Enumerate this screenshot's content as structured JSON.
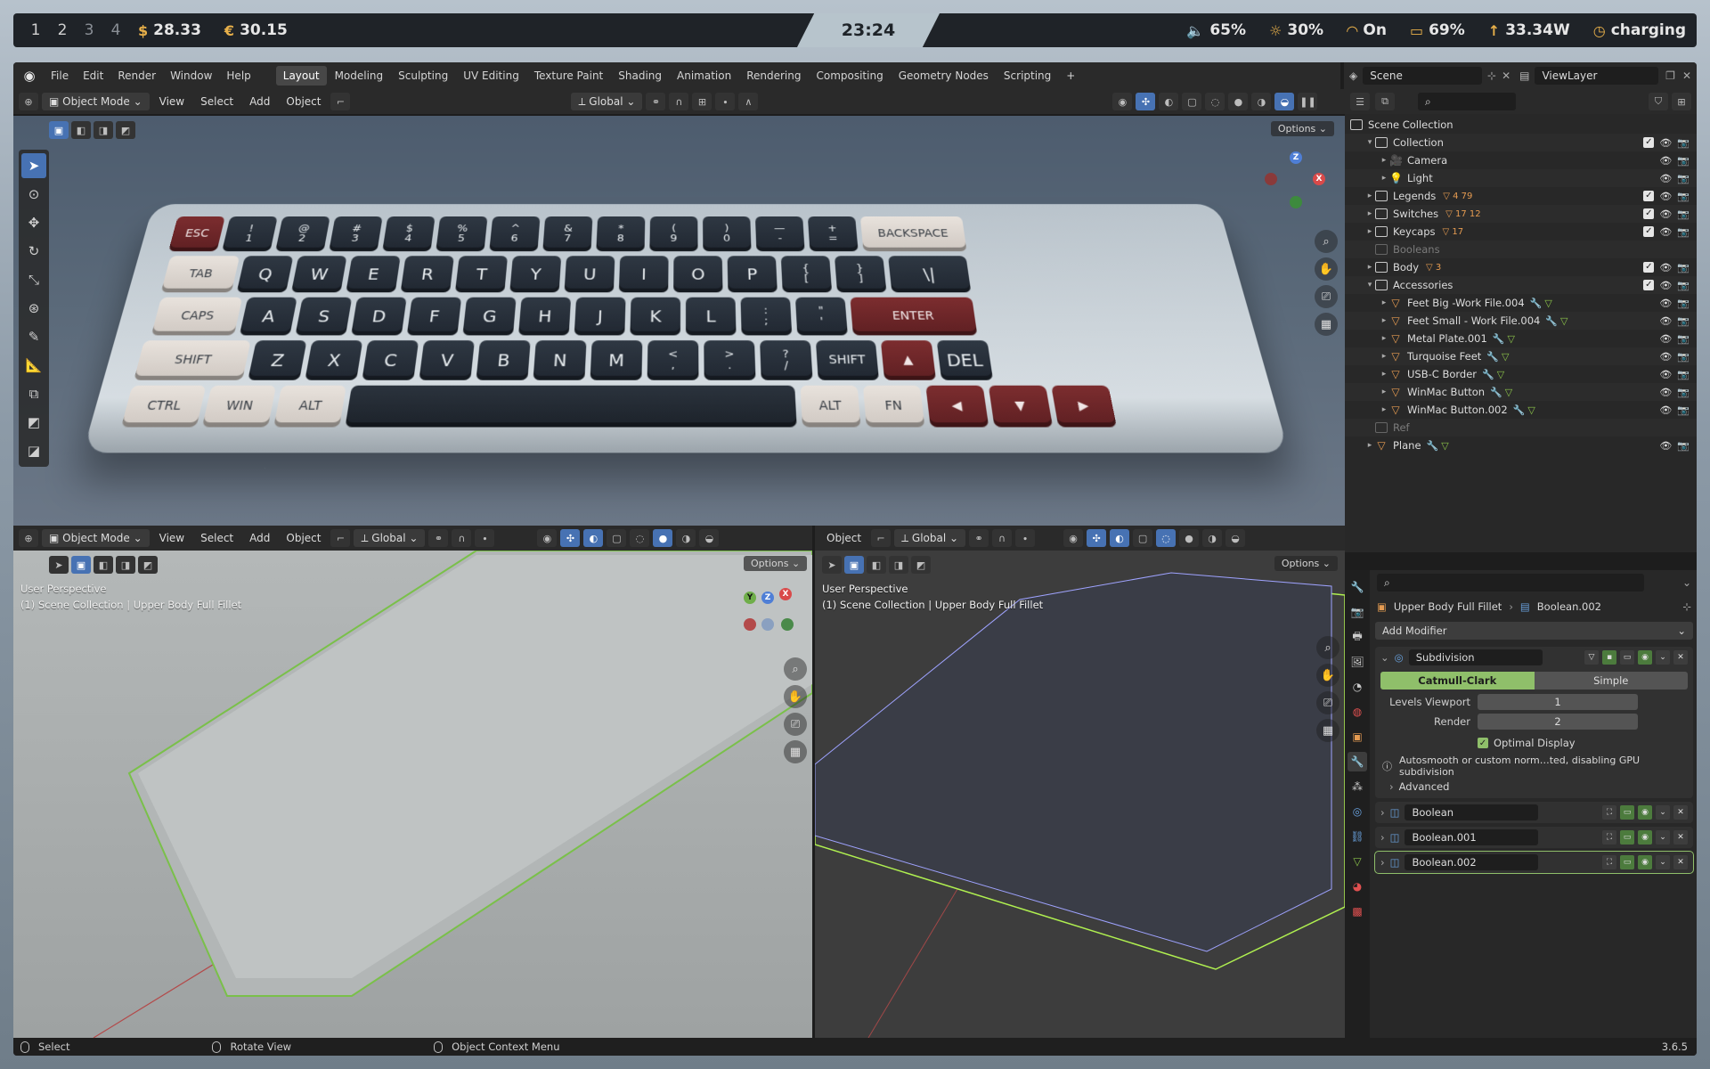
{
  "sysbar": {
    "workspaces": [
      "1",
      "2",
      "3",
      "4"
    ],
    "usd": "28.33",
    "eur": "30.15",
    "usd_icon": "$",
    "eur_icon": "€",
    "clock": "23:24",
    "volume": "65%",
    "brightness": "30%",
    "wifi": "On",
    "battery": "69%",
    "power": "33.34W",
    "charge_state": "charging"
  },
  "blender": {
    "menus": [
      "File",
      "Edit",
      "Render",
      "Window",
      "Help"
    ],
    "workspace_tabs": [
      "Layout",
      "Modeling",
      "Sculpting",
      "UV Editing",
      "Texture Paint",
      "Shading",
      "Animation",
      "Rendering",
      "Compositing",
      "Geometry Nodes",
      "Scripting"
    ],
    "active_tab": "Layout",
    "add_tab": "+",
    "scene_name": "Scene",
    "view_layer": "ViewLayer"
  },
  "viewport_header": {
    "mode": "Object Mode",
    "view": "View",
    "select": "Select",
    "add": "Add",
    "object": "Object",
    "orientation": "Global"
  },
  "viewport_main": {
    "options": "Options",
    "keyboard_rows": [
      [
        "ESC",
        "!\n1",
        "@\n2",
        "#\n3",
        "$\n4",
        "%\n5",
        "^\n6",
        "&\n7",
        "*\n8",
        "(\n9",
        ")\n0",
        "—\n-",
        "+\n=",
        "BACKSPACE"
      ],
      [
        "TAB",
        "Q",
        "W",
        "E",
        "R",
        "T",
        "Y",
        "U",
        "I",
        "O",
        "P",
        "{\n[",
        "}\n]",
        "\\|"
      ],
      [
        "CAPS",
        "A",
        "S",
        "D",
        "F",
        "G",
        "H",
        "J",
        "K",
        "L",
        ":\n;",
        "\"\n'",
        "ENTER"
      ],
      [
        "SHIFT",
        "Z",
        "X",
        "C",
        "V",
        "B",
        "N",
        "M",
        "<\n,",
        ">\n.",
        "?\n/",
        "SHIFT",
        "▲",
        "DEL"
      ],
      [
        "CTRL",
        "WIN",
        "ALT",
        "",
        "ALT",
        "FN",
        "◀",
        "▼",
        "▶"
      ]
    ]
  },
  "viewport_left": {
    "info_line1": "User Perspective",
    "info_line2": "(1) Scene Collection | Upper Body Full Fillet",
    "options": "Options"
  },
  "viewport_right": {
    "object": "Object",
    "orientation": "Global",
    "info_line1": "User Perspective",
    "info_line2": "(1) Scene Collection | Upper Body Full Fillet",
    "options": "Options"
  },
  "outliner": {
    "root": "Scene Collection",
    "rows": [
      {
        "name": "Collection",
        "kind": "collection",
        "indent": 1,
        "checked": true
      },
      {
        "name": "Camera",
        "kind": "camera",
        "indent": 2,
        "checked": false
      },
      {
        "name": "Light",
        "kind": "light",
        "indent": 2,
        "checked": false
      },
      {
        "name": "Legends",
        "kind": "collection",
        "indent": 1,
        "checked": true,
        "badge": "4 79"
      },
      {
        "name": "Switches",
        "kind": "collection",
        "indent": 1,
        "checked": true,
        "badge": "17 12"
      },
      {
        "name": "Keycaps",
        "kind": "collection",
        "indent": 1,
        "checked": true,
        "badge": "17"
      },
      {
        "name": "Booleans",
        "kind": "disabled",
        "indent": 1,
        "checked": false
      },
      {
        "name": "Body",
        "kind": "collection",
        "indent": 1,
        "checked": true,
        "badge": "3"
      },
      {
        "name": "Accessories",
        "kind": "collection",
        "indent": 1,
        "checked": true
      },
      {
        "name": "Feet Big -Work File.004",
        "kind": "mesh",
        "indent": 2,
        "checked": false
      },
      {
        "name": "Feet Small - Work File.004",
        "kind": "mesh",
        "indent": 2,
        "checked": false
      },
      {
        "name": "Metal Plate.001",
        "kind": "mesh",
        "indent": 2,
        "checked": false
      },
      {
        "name": "Turquoise Feet",
        "kind": "mesh",
        "indent": 2,
        "checked": false
      },
      {
        "name": "USB-C Border",
        "kind": "mesh",
        "indent": 2,
        "checked": false
      },
      {
        "name": "WinMac Button",
        "kind": "mesh",
        "indent": 2,
        "checked": false
      },
      {
        "name": "WinMac Button.002",
        "kind": "mesh",
        "indent": 2,
        "checked": false
      },
      {
        "name": "Ref",
        "kind": "disabled",
        "indent": 1,
        "checked": false
      },
      {
        "name": "Plane",
        "kind": "mesh",
        "indent": 1,
        "checked": false
      }
    ]
  },
  "properties": {
    "breadcrumb_object": "Upper Body Full Fillet",
    "breadcrumb_modifier": "Boolean.002",
    "add_modifier": "Add Modifier",
    "subdivision": {
      "name": "Subdivision",
      "mode_a": "Catmull-Clark",
      "mode_b": "Simple",
      "levels_viewport_label": "Levels Viewport",
      "levels_viewport": "1",
      "render_label": "Render",
      "render": "2",
      "optimal_display": "Optimal Display",
      "warning": "Autosmooth or custom norm…ted, disabling GPU subdivision",
      "advanced": "Advanced"
    },
    "modifiers": [
      "Boolean",
      "Boolean.001",
      "Boolean.002"
    ]
  },
  "statusbar": {
    "select": "Select",
    "rotate": "Rotate View",
    "context": "Object Context Menu",
    "version": "3.6.5"
  }
}
